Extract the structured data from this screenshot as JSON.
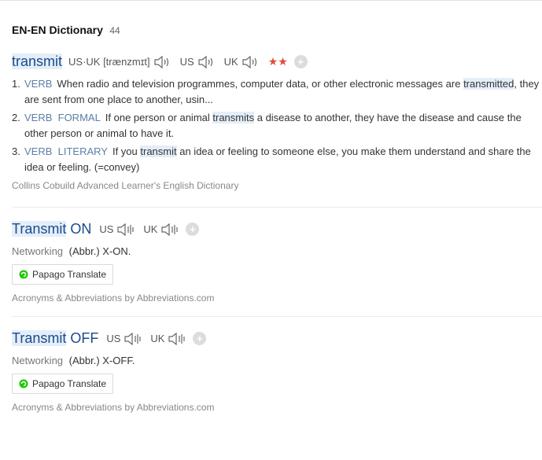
{
  "header": {
    "title": "EN-EN Dictionary",
    "count": "44"
  },
  "entry1": {
    "word": "transmit",
    "pron": "US·UK [trænzmɪt]",
    "us_label": "US",
    "uk_label": "UK",
    "stars": "★★",
    "senses": [
      {
        "num": "1.",
        "pos": "VERB",
        "pre": "When radio and television programmes, computer data, or other electronic messages are ",
        "hl": "transmitted",
        "post": ", they are sent from one place to another, usin..."
      },
      {
        "num": "2.",
        "pos": "VERB  FORMAL",
        "pre": "If one person or animal ",
        "hl": "transmits",
        "post": " a disease to another, they have the disease and cause the other person or animal to have it."
      },
      {
        "num": "3.",
        "pos": "VERB  LITERARY",
        "pre": "If you ",
        "hl": "transmit",
        "post": " an idea or feeling to someone else, you make them understand and share the idea or feeling. (=convey)"
      }
    ],
    "source": "Collins Cobuild Advanced Learner's English Dictionary"
  },
  "entry2": {
    "word_hl": "Transmit",
    "word_rest": " ON",
    "us_label": "US",
    "uk_label": "UK",
    "category": "Networking",
    "definition": "(Abbr.) X-ON.",
    "translate_label": "Papago Translate",
    "source": "Acronyms & Abbreviations by Abbreviations.com"
  },
  "entry3": {
    "word_hl": "Transmit",
    "word_rest": " OFF",
    "us_label": "US",
    "uk_label": "UK",
    "category": "Networking",
    "definition": "(Abbr.) X-OFF.",
    "translate_label": "Papago Translate",
    "source": "Acronyms & Abbreviations by Abbreviations.com"
  },
  "colors": {
    "word": "#1a4b8c",
    "pos": "#5b7fa8",
    "highlight": "#e4eef9",
    "stars": "#e04b3c",
    "papago": "#1ec800"
  },
  "icons": [
    "speaker-icon",
    "add-icon",
    "papago-icon"
  ]
}
